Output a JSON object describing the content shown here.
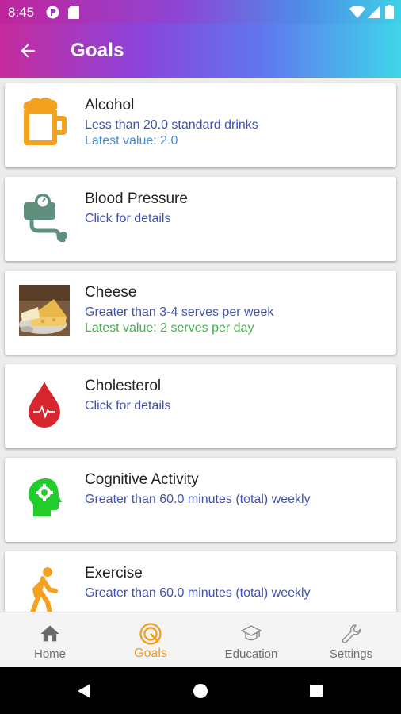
{
  "status_bar": {
    "time": "8:45",
    "icons": [
      "app-notification-icon",
      "sd-card-icon",
      "wifi-icon",
      "signal-icon",
      "battery-icon"
    ]
  },
  "app_bar": {
    "title": "Goals",
    "back_icon": "arrow-back-icon"
  },
  "goals": [
    {
      "name": "Alcohol",
      "icon": "beer-mug-icon",
      "line1": "Less than 20.0 standard drinks",
      "line2": "Latest value: 2.0",
      "line2_color": "#3f8fe0"
    },
    {
      "name": "Blood Pressure",
      "icon": "blood-pressure-icon",
      "line1": "Click for details",
      "line2": ""
    },
    {
      "name": "Cheese",
      "icon": "cheese-photo",
      "line1": "Greater than 3-4 serves per week",
      "line2": "Latest value: 2 serves per day",
      "line2_color": "#46b04a"
    },
    {
      "name": "Cholesterol",
      "icon": "blood-drop-icon",
      "line1": "Click for details",
      "line2": ""
    },
    {
      "name": "Cognitive Activity",
      "icon": "head-gears-icon",
      "line1": "Greater than 60.0 minutes (total) weekly",
      "line2": ""
    },
    {
      "name": "Exercise",
      "icon": "walking-person-icon",
      "line1": "Greater than 60.0 minutes (total) weekly",
      "line2": ""
    }
  ],
  "bottom_nav": [
    {
      "label": "Home",
      "icon": "home-icon",
      "active": false
    },
    {
      "label": "Goals",
      "icon": "target-icon",
      "active": true
    },
    {
      "label": "Education",
      "icon": "graduation-cap-icon",
      "active": false
    },
    {
      "label": "Settings",
      "icon": "wrench-icon",
      "active": false
    }
  ],
  "colors": {
    "accent": "#f39b1b",
    "line1_text": "#3f51b5",
    "latest_blue": "#3f8fe0",
    "latest_green": "#46b04a"
  },
  "system_nav": [
    "back-triangle-icon",
    "home-circle-icon",
    "recents-square-icon"
  ]
}
